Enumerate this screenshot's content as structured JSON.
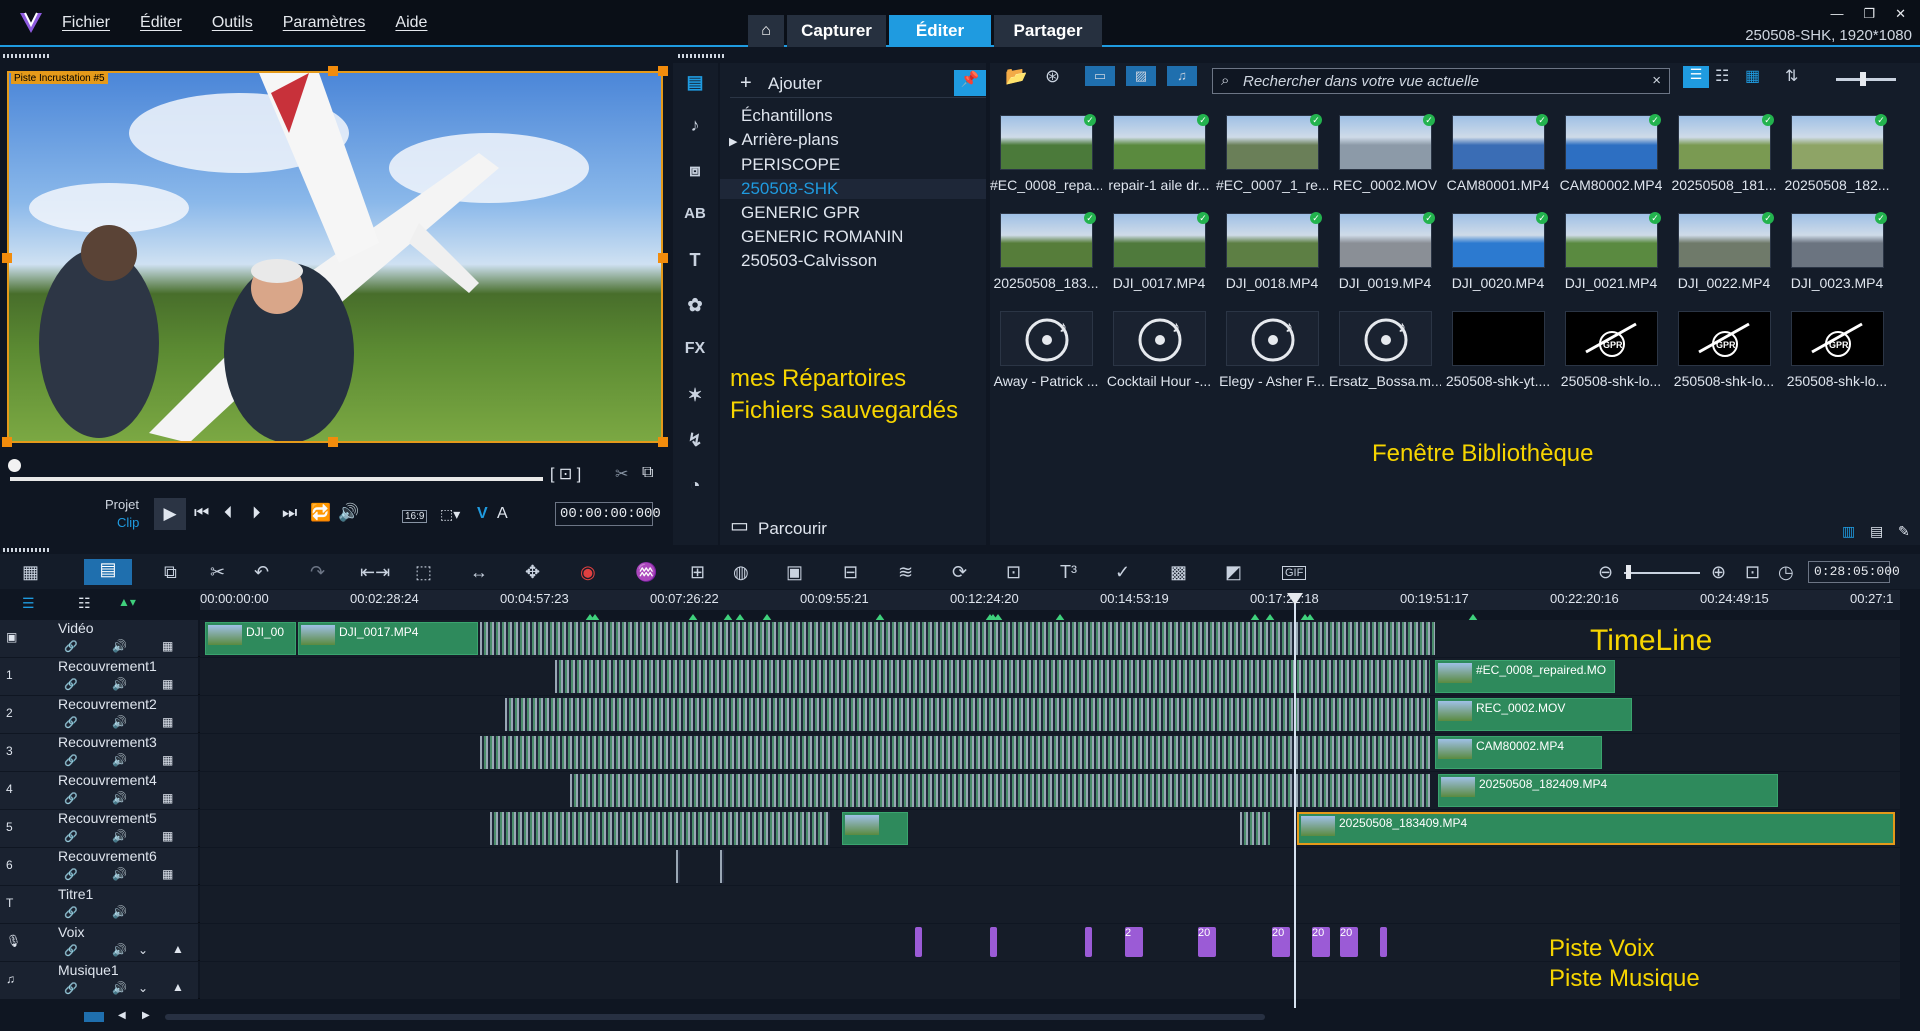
{
  "menu": [
    "Fichier",
    "Éditer",
    "Outils",
    "Paramètres",
    "Aide"
  ],
  "modes": {
    "home": "⌂",
    "capture": "Capturer",
    "edit": "Éditer",
    "share": "Partager"
  },
  "window": {
    "minimize": "—",
    "restore": "❐",
    "close": "✕"
  },
  "project_info": "250508-SHK, 1920*1080",
  "preview": {
    "overlay_label": "Piste Incrustation #5",
    "project_label": "Projet",
    "clip_label": "Clip",
    "timecode": "00:00:00:000",
    "aspect": "16:9"
  },
  "library": {
    "add_label": "Ajouter",
    "browse_label": "Parcourir",
    "folders": [
      "Échantillons",
      "Arrière-plans",
      "PERISCOPE",
      "250508-SHK",
      "GENERIC GPR",
      "GENERIC ROMANIN",
      "250503-Calvisson"
    ],
    "selected_folder": "250508-SHK",
    "search_placeholder": "Rechercher dans votre vue actuelle",
    "items": [
      {
        "name": "#EC_0008_repa...",
        "kind": "video",
        "tone": "#4b7a3a"
      },
      {
        "name": "repair-1 aile dr...",
        "kind": "video",
        "tone": "#5a8a3e"
      },
      {
        "name": "#EC_0007_1_re...",
        "kind": "video",
        "tone": "#6a7f58"
      },
      {
        "name": "REC_0002.MOV",
        "kind": "video",
        "tone": "#8c9aa8"
      },
      {
        "name": "CAM80001.MP4",
        "kind": "video",
        "tone": "#3a6db5"
      },
      {
        "name": "CAM80002.MP4",
        "kind": "video",
        "tone": "#2d6fc2"
      },
      {
        "name": "20250508_181...",
        "kind": "video",
        "tone": "#7a9a52"
      },
      {
        "name": "20250508_182...",
        "kind": "video",
        "tone": "#8ea466"
      },
      {
        "name": "20250508_183...",
        "kind": "video",
        "tone": "#567d3a"
      },
      {
        "name": "DJI_0017.MP4",
        "kind": "video",
        "tone": "#4f7a3c"
      },
      {
        "name": "DJI_0018.MP4",
        "kind": "video",
        "tone": "#5d7f44"
      },
      {
        "name": "DJI_0019.MP4",
        "kind": "video",
        "tone": "#8a8f96"
      },
      {
        "name": "DJI_0020.MP4",
        "kind": "video",
        "tone": "#2c7ad0"
      },
      {
        "name": "DJI_0021.MP4",
        "kind": "video",
        "tone": "#5a8a40"
      },
      {
        "name": "DJI_0022.MP4",
        "kind": "video",
        "tone": "#6f7a6a"
      },
      {
        "name": "DJI_0023.MP4",
        "kind": "video",
        "tone": "#6b7480"
      },
      {
        "name": "Away - Patrick ...",
        "kind": "audio",
        "tone": "#1a2230"
      },
      {
        "name": "Cocktail Hour -...",
        "kind": "audio",
        "tone": "#1a2230"
      },
      {
        "name": "Elegy - Asher F...",
        "kind": "audio",
        "tone": "#1a2230"
      },
      {
        "name": "Ersatz_Bossa.m...",
        "kind": "audio",
        "tone": "#1a2230"
      },
      {
        "name": "250508-shk-yt....",
        "kind": "blank",
        "tone": "#000000"
      },
      {
        "name": "250508-shk-lo...",
        "kind": "logo",
        "tone": "#000000"
      },
      {
        "name": "250508-shk-lo...",
        "kind": "logo",
        "tone": "#000000"
      },
      {
        "name": "250508-shk-lo...",
        "kind": "logo",
        "tone": "#000000"
      }
    ]
  },
  "annotations": {
    "folders_line1": "mes Répartoires",
    "folders_line2": "Fichiers sauvegardés",
    "library": "Fenêtre Bibliothèque",
    "timeline": "TimeLine",
    "voice": "Piste Voix",
    "music": "Piste Musique"
  },
  "timeline": {
    "duration": "0:28:05:000",
    "ruler": [
      "00:00:00:00",
      "00:02:28:24",
      "00:04:57:23",
      "00:07:26:22",
      "00:09:55:21",
      "00:12:24:20",
      "00:14:53:19",
      "00:17:22:18",
      "00:19:51:17",
      "00:22:20:16",
      "00:24:49:15",
      "00:27:1"
    ],
    "tracks": [
      "Vidéo",
      "Recouvrement1",
      "Recouvrement2",
      "Recouvrement3",
      "Recouvrement4",
      "Recouvrement5",
      "Recouvrement6",
      "Titre1",
      "Voix",
      "Musique1"
    ],
    "clips": {
      "c1": "DJI_00",
      "c2": "DJI_0017.MP4",
      "c3": "#EC_0008_repaired.MO",
      "c4": "REC_0002.MOV",
      "c5": "CAM80002.MP4",
      "c6": "20250508_182409.MP4",
      "c7": "20250508_183409.MP4"
    },
    "voice_labels": [
      "2",
      "20",
      "20",
      "20",
      "20"
    ]
  },
  "colors": {
    "accent": "#1f9be0",
    "clip": "#2e8a5c",
    "voice": "#9b5bd6",
    "selection": "#e59a1a",
    "annotation": "#f7d500"
  }
}
